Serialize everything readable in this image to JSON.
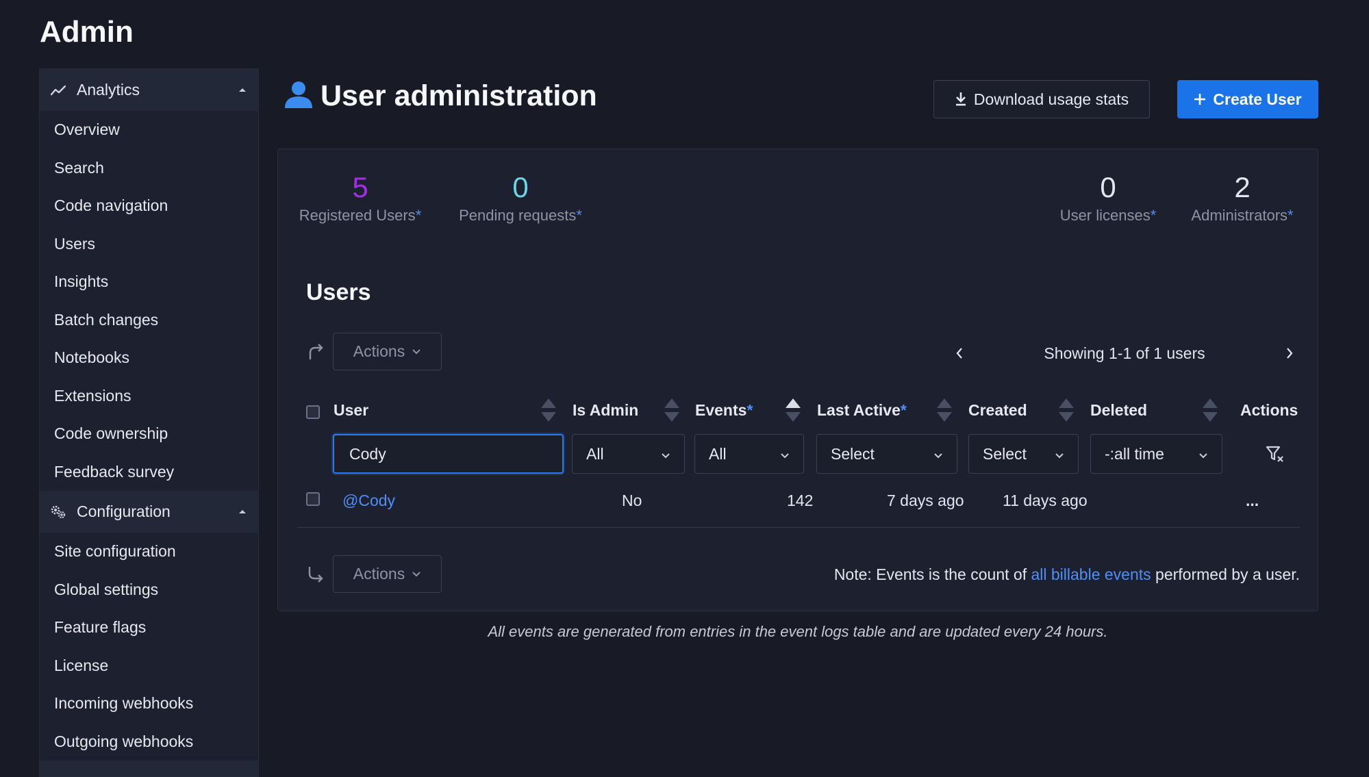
{
  "page_title": "Admin",
  "sidebar": {
    "groups": [
      {
        "label": "Analytics",
        "icon": "line-chart-icon",
        "items": [
          "Overview",
          "Search",
          "Code navigation",
          "Users",
          "Insights",
          "Batch changes",
          "Notebooks",
          "Extensions",
          "Code ownership",
          "Feedback survey"
        ]
      },
      {
        "label": "Configuration",
        "icon": "gears-icon",
        "items": [
          "Site configuration",
          "Global settings",
          "Feature flags",
          "License",
          "Incoming webhooks",
          "Outgoing webhooks"
        ]
      }
    ]
  },
  "header": {
    "title": "User administration",
    "title_icon": "user-icon",
    "download_label": "Download usage stats",
    "create_label": "Create User"
  },
  "stats": {
    "registered": {
      "value": "5",
      "label": "Registered Users",
      "color": "#a42ee8"
    },
    "pending": {
      "value": "0",
      "label": "Pending requests",
      "color": "#6bd4e6"
    },
    "licenses": {
      "value": "0",
      "label": "User licenses",
      "color": "#e2e6ee"
    },
    "admins": {
      "value": "2",
      "label": "Administrators",
      "color": "#e2e6ee"
    },
    "asterisk": "*"
  },
  "users": {
    "heading": "Users",
    "actions_label": "Actions",
    "pager_text": "Showing 1-1 of 1 users",
    "columns": {
      "user": "User",
      "is_admin": "Is Admin",
      "events": "Events",
      "last_active": "Last Active",
      "created": "Created",
      "deleted": "Deleted",
      "actions": "Actions"
    },
    "filters": {
      "user_query": "Cody",
      "is_admin": "All",
      "events": "All",
      "last_active": "Select",
      "created": "Select",
      "deleted": "-:all time"
    },
    "rows": [
      {
        "user": "@Cody",
        "is_admin": "No",
        "events": "142",
        "last_active": "7 days ago",
        "created": "11 days ago",
        "actions": "..."
      }
    ],
    "note_prefix": "Note: Events is the count of ",
    "note_link": "all billable events",
    "note_suffix": " performed by a user."
  },
  "footer_note": "All events are generated from entries in the event logs table and are updated every 24 hours."
}
